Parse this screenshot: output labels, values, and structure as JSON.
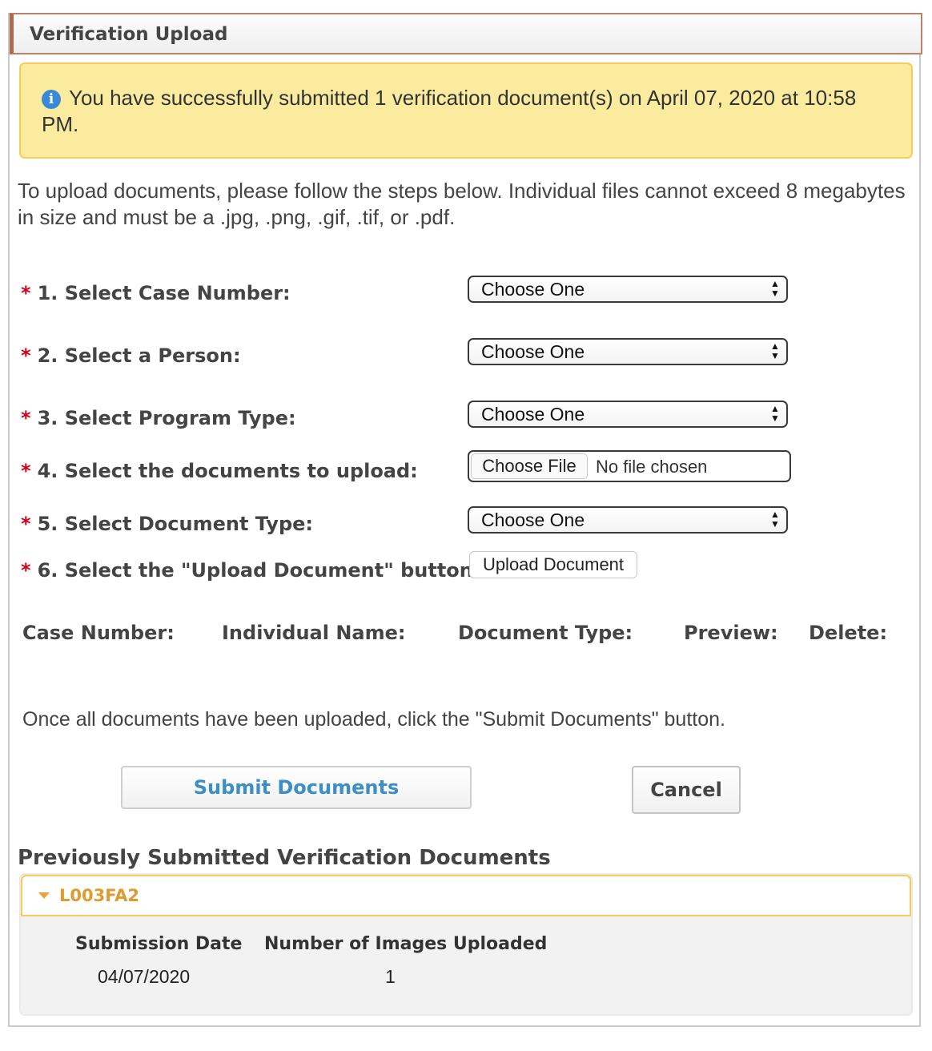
{
  "panel": {
    "title": "Verification Upload"
  },
  "alert": {
    "icon": "info-icon",
    "message": "You have successfully submitted 1 verification document(s) on April 07, 2020 at 10:58 PM."
  },
  "intro_text": "To upload documents, please follow the steps below. Individual files cannot exceed 8 megabytes in size and must be a .jpg, .png, .gif, .tif, or .pdf.",
  "steps": {
    "required_marker": "*",
    "case_number": {
      "label": "1. Select Case Number:",
      "value": "Choose One"
    },
    "person": {
      "label": "2. Select a Person:",
      "value": "Choose One"
    },
    "program_type": {
      "label": "3. Select Program Type:",
      "value": "Choose One"
    },
    "documents": {
      "label": "4. Select the documents to upload:",
      "button": "Choose File",
      "status": "No file chosen"
    },
    "document_type": {
      "label": "5. Select Document Type:",
      "value": "Choose One"
    },
    "upload": {
      "label": "6. Select the \"Upload Document\" button:",
      "button": "Upload Document"
    }
  },
  "uploaded_table": {
    "headers": [
      "Case Number:",
      "Individual Name:",
      "Document Type:",
      "Preview:",
      "Delete:"
    ]
  },
  "submit_instruction": "Once all documents have been uploaded, click the \"Submit Documents\" button.",
  "buttons": {
    "submit": "Submit Documents",
    "cancel": "Cancel"
  },
  "previous": {
    "title": "Previously Submitted Verification Documents",
    "case_id": "L003FA2",
    "columns": [
      "Submission Date",
      "Number of Images Uploaded"
    ],
    "rows": [
      [
        "04/07/2020",
        "1"
      ]
    ]
  },
  "colors": {
    "header_accent": "#b06a4f",
    "alert_background": "#fbeb9f",
    "alert_border": "#f3cf5a",
    "required": "#d0021b",
    "submit_text": "#3c8ec4",
    "case_id": "#e09a30"
  }
}
